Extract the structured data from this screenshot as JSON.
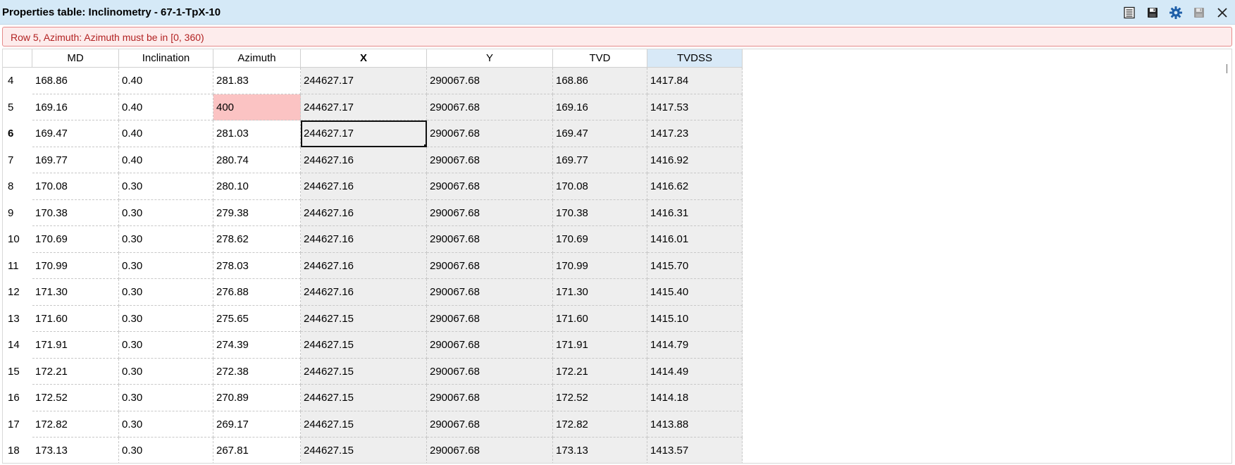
{
  "window": {
    "title": "Properties table: Inclinometry - 67-1-TpX-10",
    "toolbar": {
      "icons": [
        "table-list-icon",
        "save-icon",
        "settings-gear-icon",
        "save-disabled-icon",
        "close-icon"
      ]
    }
  },
  "error": {
    "message": "Row 5, Azimuth: Azimuth must be in [0, 360)"
  },
  "table": {
    "columns": [
      {
        "label": "MD"
      },
      {
        "label": "Inclination"
      },
      {
        "label": "Azimuth"
      },
      {
        "label": "X"
      },
      {
        "label": "Y"
      },
      {
        "label": "TVD"
      },
      {
        "label": "TVDSS"
      }
    ],
    "rows": [
      {
        "num": "4",
        "cells": [
          "168.86",
          "0.40",
          "281.83",
          "244627.17",
          "290067.68",
          "168.86",
          "1417.84"
        ]
      },
      {
        "num": "5",
        "cells": [
          "169.16",
          "0.40",
          "400",
          "244627.17",
          "290067.68",
          "169.16",
          "1417.53"
        ]
      },
      {
        "num": "6",
        "cells": [
          "169.47",
          "0.40",
          "281.03",
          "244627.17",
          "290067.68",
          "169.47",
          "1417.23"
        ]
      },
      {
        "num": "7",
        "cells": [
          "169.77",
          "0.40",
          "280.74",
          "244627.16",
          "290067.68",
          "169.77",
          "1416.92"
        ]
      },
      {
        "num": "8",
        "cells": [
          "170.08",
          "0.30",
          "280.10",
          "244627.16",
          "290067.68",
          "170.08",
          "1416.62"
        ]
      },
      {
        "num": "9",
        "cells": [
          "170.38",
          "0.30",
          "279.38",
          "244627.16",
          "290067.68",
          "170.38",
          "1416.31"
        ]
      },
      {
        "num": "10",
        "cells": [
          "170.69",
          "0.30",
          "278.62",
          "244627.16",
          "290067.68",
          "170.69",
          "1416.01"
        ]
      },
      {
        "num": "11",
        "cells": [
          "170.99",
          "0.30",
          "278.03",
          "244627.16",
          "290067.68",
          "170.99",
          "1415.70"
        ]
      },
      {
        "num": "12",
        "cells": [
          "171.30",
          "0.30",
          "276.88",
          "244627.16",
          "290067.68",
          "171.30",
          "1415.40"
        ]
      },
      {
        "num": "13",
        "cells": [
          "171.60",
          "0.30",
          "275.65",
          "244627.15",
          "290067.68",
          "171.60",
          "1415.10"
        ]
      },
      {
        "num": "14",
        "cells": [
          "171.91",
          "0.30",
          "274.39",
          "244627.15",
          "290067.68",
          "171.91",
          "1414.79"
        ]
      },
      {
        "num": "15",
        "cells": [
          "172.21",
          "0.30",
          "272.38",
          "244627.15",
          "290067.68",
          "172.21",
          "1414.49"
        ]
      },
      {
        "num": "16",
        "cells": [
          "172.52",
          "0.30",
          "270.89",
          "244627.15",
          "290067.68",
          "172.52",
          "1414.18"
        ]
      },
      {
        "num": "17",
        "cells": [
          "172.82",
          "0.30",
          "269.17",
          "244627.15",
          "290067.68",
          "172.82",
          "1413.88"
        ]
      },
      {
        "num": "18",
        "cells": [
          "173.13",
          "0.30",
          "267.81",
          "244627.15",
          "290067.68",
          "173.13",
          "1413.57"
        ]
      }
    ]
  },
  "colors": {
    "titlebar": "#d5e9f7",
    "error_background": "#fdecec",
    "error_text": "#b22222",
    "invalid_cell": "#fbc3c3",
    "readonly_cell": "#eeeeee",
    "icon_blue": "#1f5fa8"
  }
}
